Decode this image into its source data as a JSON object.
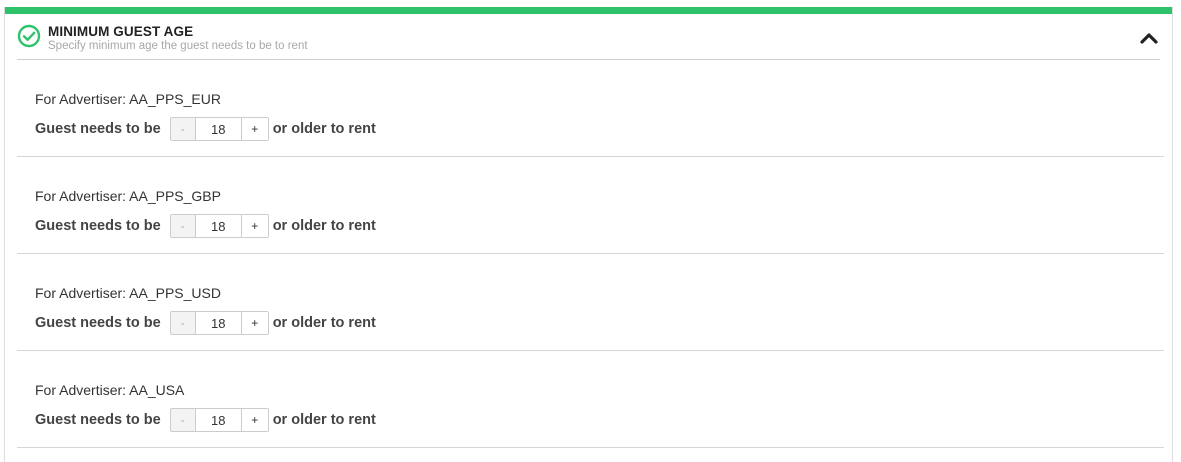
{
  "colors": {
    "accent": "#2ec26a",
    "border": "#cccccc"
  },
  "section": {
    "title": "MINIMUM GUEST AGE",
    "subtitle": "Specify minimum age the guest needs to be to rent",
    "status_icon": "check-circle-icon",
    "collapse_icon": "chevron-up-icon"
  },
  "entries": [
    {
      "advertiser_label": "For Advertiser: AA_PPS_EUR",
      "prefix": "Guest needs to be",
      "decrement": "-",
      "value": "18",
      "increment": "+",
      "suffix": "or older to rent"
    },
    {
      "advertiser_label": "For Advertiser: AA_PPS_GBP",
      "prefix": "Guest needs to be",
      "decrement": "-",
      "value": "18",
      "increment": "+",
      "suffix": "or older to rent"
    },
    {
      "advertiser_label": "For Advertiser: AA_PPS_USD",
      "prefix": "Guest needs to be",
      "decrement": "-",
      "value": "18",
      "increment": "+",
      "suffix": "or older to rent"
    },
    {
      "advertiser_label": "For Advertiser: AA_USA",
      "prefix": "Guest needs to be",
      "decrement": "-",
      "value": "18",
      "increment": "+",
      "suffix": "or older to rent"
    }
  ]
}
